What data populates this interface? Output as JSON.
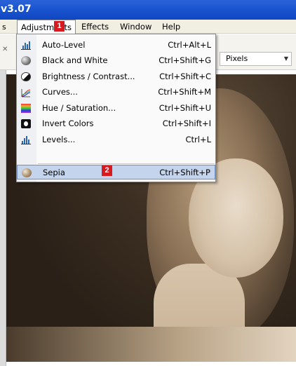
{
  "window": {
    "title": "v3.07"
  },
  "menubar": {
    "fragment": "s",
    "items": [
      {
        "label": "Adjustments",
        "open": true
      },
      {
        "label": "Effects"
      },
      {
        "label": "Window"
      },
      {
        "label": "Help"
      }
    ]
  },
  "toolbar": {
    "units_value": "Pixels",
    "units_icon": "chevron-down-icon"
  },
  "adjustments_menu": {
    "items": [
      {
        "label": "Auto-Level",
        "shortcut": "Ctrl+Alt+L",
        "icon": "histogram-icon"
      },
      {
        "label": "Black and White",
        "shortcut": "Ctrl+Shift+G",
        "icon": "grayscale-icon"
      },
      {
        "label": "Brightness / Contrast...",
        "shortcut": "Ctrl+Shift+C",
        "icon": "contrast-icon"
      },
      {
        "label": "Curves...",
        "shortcut": "Ctrl+Shift+M",
        "icon": "curves-icon"
      },
      {
        "label": "Hue / Saturation...",
        "shortcut": "Ctrl+Shift+U",
        "icon": "hue-icon"
      },
      {
        "label": "Invert Colors",
        "shortcut": "Ctrl+Shift+I",
        "icon": "invert-icon"
      },
      {
        "label": "Levels...",
        "shortcut": "Ctrl+L",
        "icon": "levels-icon"
      },
      {
        "label": "Sepia",
        "shortcut": "Ctrl+Shift+P",
        "icon": "sepia-icon",
        "selected": true
      }
    ]
  },
  "callouts": {
    "one": "1",
    "two": "2"
  },
  "colors": {
    "title_bar": "#1c55d0",
    "callout": "#d71920",
    "highlight": "#c3d4ec"
  }
}
